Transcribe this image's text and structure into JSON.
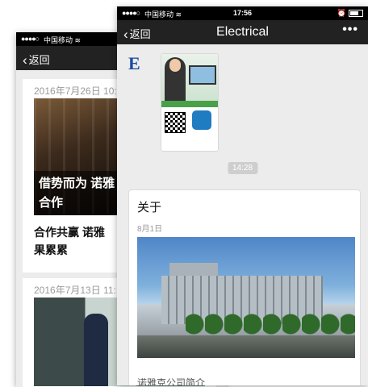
{
  "back_phone": {
    "status": {
      "signal": "●●●●○",
      "carrier": "中国移动"
    },
    "nav": {
      "back_label": "返回"
    },
    "cards": [
      {
        "date": "2016年7月26日 10:",
        "overlay": "借势而为 诺雅\n合作",
        "headline": "合作共赢 诺雅\n果累累"
      },
      {
        "date": "2016年7月13日 11:"
      }
    ]
  },
  "front_phone": {
    "status": {
      "signal": "●●●●○",
      "carrier": "中国移动",
      "time": "17:56"
    },
    "nav": {
      "back_label": "返回",
      "title": "Electrical",
      "more": "•••"
    },
    "avatar_letter": "E",
    "time_divider": "14:28",
    "article": {
      "title": "关于",
      "date": "8月1日",
      "caption": "诺雅克公司简介"
    }
  },
  "icons": [
    "wifi-icon",
    "alarm-icon",
    "battery-icon",
    "chevron-left-icon",
    "more-icon",
    "qr-code-icon"
  ]
}
